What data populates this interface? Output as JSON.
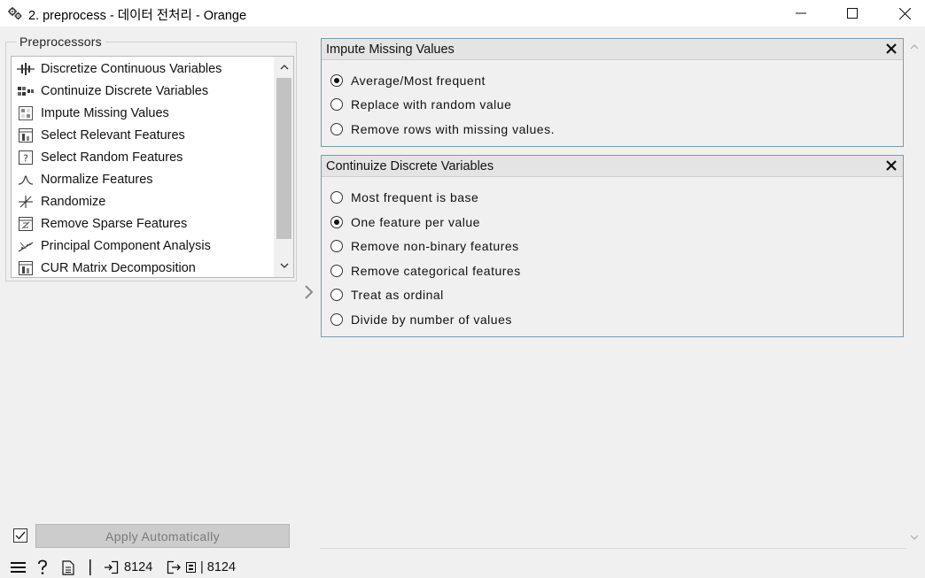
{
  "window": {
    "title": "2. preprocess - 데이터 전처리 - Orange",
    "icon": "gears-icon",
    "controls": [
      "minimize-icon",
      "maximize-icon",
      "close-icon"
    ]
  },
  "preprocessors": {
    "group_title": "Preprocessors",
    "items": [
      {
        "label": "Discretize Continuous Variables",
        "icon": "discretize-icon"
      },
      {
        "label": "Continuize Discrete Variables",
        "icon": "continuize-icon"
      },
      {
        "label": "Impute Missing Values",
        "icon": "impute-icon"
      },
      {
        "label": "Select Relevant Features",
        "icon": "select-relevant-icon"
      },
      {
        "label": "Select Random Features",
        "icon": "select-random-icon"
      },
      {
        "label": "Normalize Features",
        "icon": "normalize-icon"
      },
      {
        "label": "Randomize",
        "icon": "randomize-icon"
      },
      {
        "label": "Remove Sparse Features",
        "icon": "remove-sparse-icon"
      },
      {
        "label": "Principal Component Analysis",
        "icon": "pca-icon"
      },
      {
        "label": "CUR Matrix Decomposition",
        "icon": "cur-icon"
      }
    ]
  },
  "panels": [
    {
      "title": "Impute Missing Values",
      "options": [
        {
          "label": "Average/Most frequent",
          "selected": true
        },
        {
          "label": "Replace with random value",
          "selected": false
        },
        {
          "label": "Remove rows with missing values.",
          "selected": false
        }
      ]
    },
    {
      "title": "Continuize Discrete Variables",
      "options": [
        {
          "label": "Most frequent is base",
          "selected": false
        },
        {
          "label": "One feature per value",
          "selected": true
        },
        {
          "label": "Remove non-binary features",
          "selected": false
        },
        {
          "label": "Remove categorical features",
          "selected": false
        },
        {
          "label": "Treat as ordinal",
          "selected": false
        },
        {
          "label": "Divide by number of values",
          "selected": false
        }
      ]
    }
  ],
  "footer": {
    "apply_auto_checked": true,
    "apply_label": "Apply Automatically"
  },
  "statusbar": {
    "input_count": "8124",
    "output_count": "| 8124"
  }
}
